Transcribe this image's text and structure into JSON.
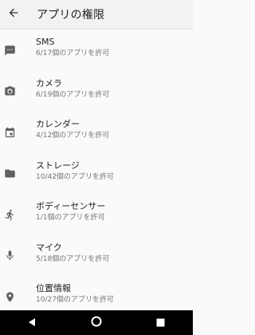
{
  "appbar": {
    "title": "アプリの権限",
    "back_icon": "arrow-back-icon"
  },
  "permissions": [
    {
      "icon": "sms-icon",
      "name": "SMS",
      "count": "6/17個のアプリを許可"
    },
    {
      "icon": "camera-icon",
      "name": "カメラ",
      "count": "6/19個のアプリを許可"
    },
    {
      "icon": "calendar-icon",
      "name": "カレンダー",
      "count": "4/12個のアプリを許可"
    },
    {
      "icon": "folder-icon",
      "name": "ストレージ",
      "count": "10/42個のアプリを許可"
    },
    {
      "icon": "running-person-icon",
      "name": "ボディーセンサー",
      "count": "1/1個のアプリを許可"
    },
    {
      "icon": "microphone-icon",
      "name": "マイク",
      "count": "5/18個のアプリを許可"
    },
    {
      "icon": "location-pin-icon",
      "name": "位置情報",
      "count": "10/27個のアプリを許可"
    }
  ],
  "navbar": {
    "back_icon": "nav-back-icon",
    "home_icon": "nav-home-icon",
    "recents_icon": "nav-recents-icon"
  },
  "colors": {
    "icon": "#616161",
    "text_primary": "#212121",
    "text_secondary": "#757575",
    "background": "#fafafa",
    "navbar": "#000000"
  }
}
